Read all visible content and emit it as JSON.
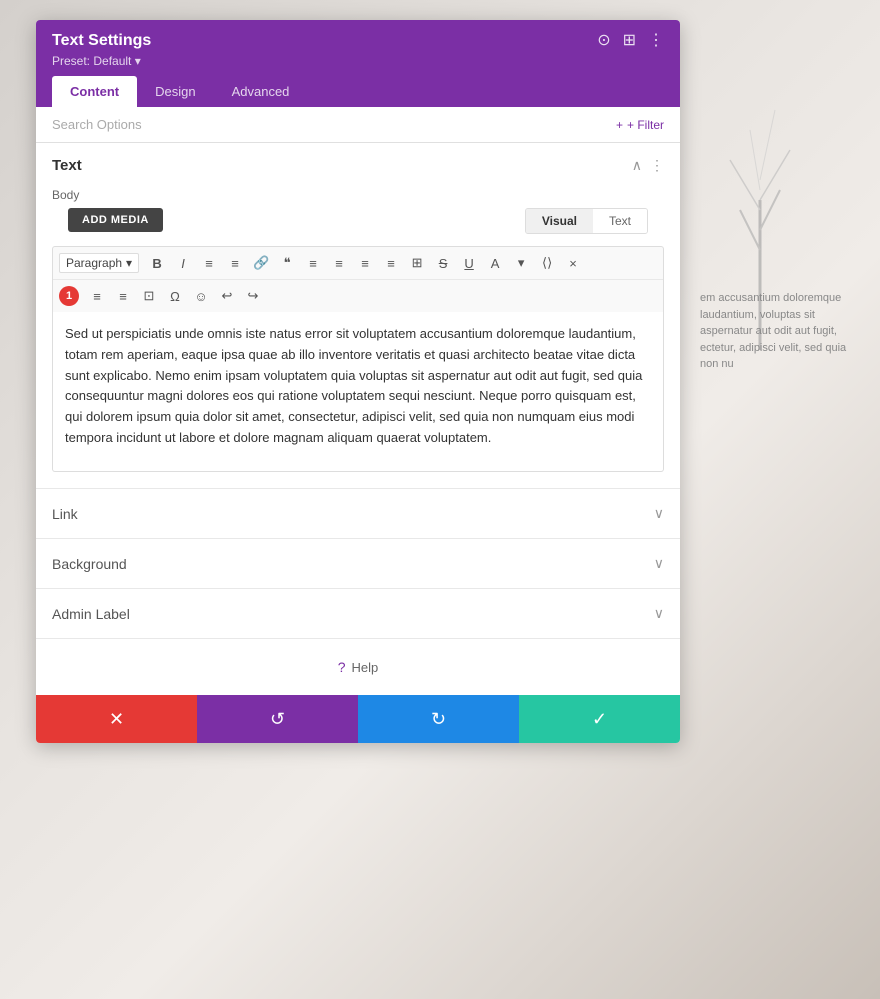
{
  "header": {
    "title": "Text Settings",
    "preset": "Preset: Default ▾",
    "tabs": [
      "Content",
      "Design",
      "Advanced"
    ],
    "active_tab": "Content",
    "icons": [
      "⊙",
      "⊞",
      "⋮"
    ]
  },
  "search": {
    "placeholder": "Search Options",
    "filter_label": "+ Filter"
  },
  "text_section": {
    "title": "Text",
    "body_label": "Body",
    "add_media": "ADD MEDIA",
    "view_toggle": {
      "visual": "Visual",
      "text": "Text",
      "active": "Visual"
    },
    "toolbar": {
      "paragraph": "Paragraph",
      "buttons": [
        "B",
        "I",
        "≡",
        "≡",
        "🔗",
        "❝",
        "≡",
        "≡",
        "≡",
        "≡",
        "⊞",
        "S̶",
        "U",
        "A",
        "▾",
        "⟨⟩",
        "×"
      ],
      "row2": [
        "≡",
        "≡",
        "⊡",
        "Ω",
        "☺",
        "↩",
        "↪"
      ]
    },
    "body_text": "Sed ut perspiciatis unde omnis iste natus error sit voluptatem accusantium doloremque laudantium, totam rem aperiam, eaque ipsa quae ab illo inventore veritatis et quasi architecto beatae vitae dicta sunt explicabo. Nemo enim ipsam voluptatem quia voluptas sit aspernatur aut odit aut fugit, sed quia consequuntur magni dolores eos qui ratione voluptatem sequi nesciunt. Neque porro quisquam est, qui dolorem ipsum quia dolor sit amet, consectetur, adipisci velit, sed quia non numquam eius modi tempora incidunt ut labore et dolore magnam aliquam quaerat voluptatem.",
    "badge": "1"
  },
  "collapsibles": [
    {
      "title": "Link"
    },
    {
      "title": "Background"
    },
    {
      "title": "Admin Label"
    }
  ],
  "help": {
    "label": "Help"
  },
  "footer": {
    "cancel": "✕",
    "undo": "↺",
    "redo": "↻",
    "save": "✓"
  }
}
